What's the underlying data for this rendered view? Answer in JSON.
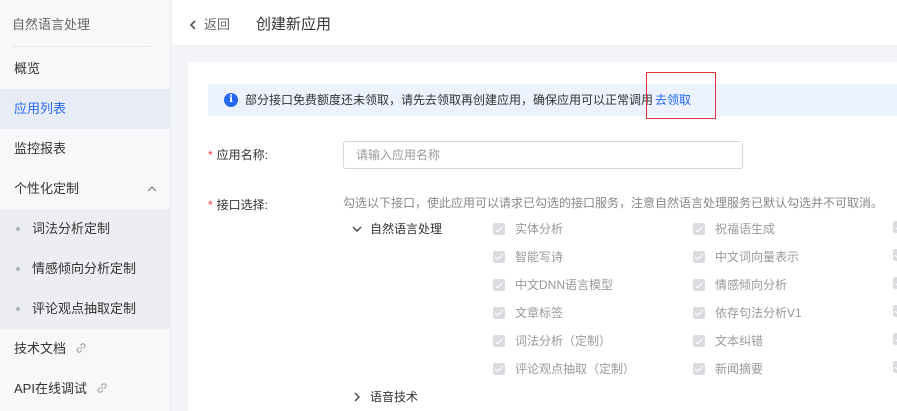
{
  "sidebar": {
    "title": "自然语言处理",
    "items": [
      {
        "label": "概览"
      },
      {
        "label": "应用列表"
      },
      {
        "label": "监控报表"
      }
    ],
    "group": {
      "label": "个性化定制"
    },
    "sub_items": [
      {
        "label": "词法分析定制"
      },
      {
        "label": "情感倾向分析定制"
      },
      {
        "label": "评论观点抽取定制"
      }
    ],
    "bottom_items": [
      {
        "label": "技术文档"
      },
      {
        "label": "API在线调试"
      }
    ]
  },
  "header": {
    "back_label": "返回",
    "title": "创建新应用"
  },
  "notice": {
    "text": "部分接口免费额度还未领取，请先去领取再创建应用，确保应用可以正常调用",
    "link": "去领取"
  },
  "form": {
    "name_label": "应用名称:",
    "name_placeholder": "请输入应用名称",
    "api_label": "接口选择:",
    "hint": "勾选以下接口，使此应用可以请求已勾选的接口服务，注意自然语言处理服务已默认勾选并不可取消。",
    "nlp_group": "自然语言处理",
    "nlp_col1": [
      "实体分析",
      "智能写诗",
      "中文DNN语言模型",
      "文章标签",
      "词法分析（定制）",
      "评论观点抽取（定制）"
    ],
    "nlp_col2": [
      "祝福语生成",
      "中文词向量表示",
      "情感倾向分析",
      "依存句法分析V1",
      "文本纠错",
      "新闻摘要"
    ],
    "speech_group": "语音技术"
  },
  "colors": {
    "accent": "#2468f2",
    "required": "#f33e3e",
    "highlight_box": "#e0303a"
  }
}
